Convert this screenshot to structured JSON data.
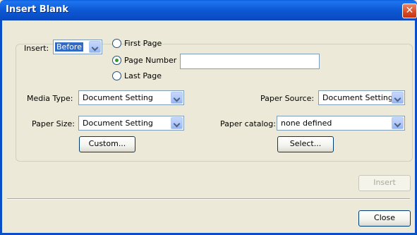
{
  "window": {
    "title": "Insert Blank",
    "close_glyph": "✕"
  },
  "insert": {
    "label": "Insert:",
    "position_value": "Before",
    "options": [
      {
        "label": "First Page",
        "checked": false
      },
      {
        "label": "Page Number",
        "checked": true
      },
      {
        "label": "Last Page",
        "checked": false
      }
    ],
    "page_number_value": ""
  },
  "media_type": {
    "label": "Media Type:",
    "value": "Document Setting"
  },
  "paper_source": {
    "label": "Paper Source:",
    "value": "Document Setting"
  },
  "paper_size": {
    "label": "Paper Size:",
    "value": "Document Setting"
  },
  "paper_catalog": {
    "label": "Paper catalog:",
    "value": "none defined"
  },
  "buttons": {
    "custom": "Custom...",
    "select": "Select...",
    "insert": "Insert",
    "close": "Close"
  }
}
